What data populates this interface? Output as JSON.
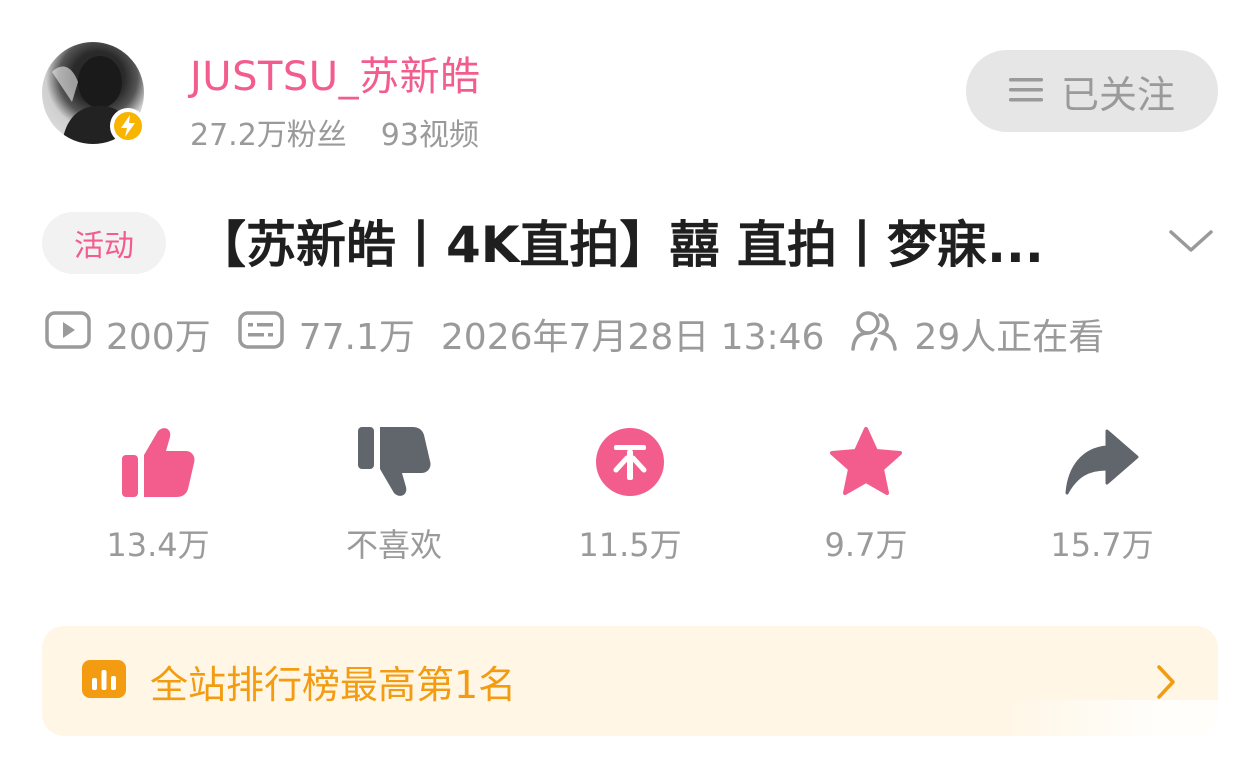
{
  "header": {
    "username": "JUSTSU_苏新皓",
    "followers": "27.2万粉丝",
    "videos": "93视频",
    "follow_button_label": "已关注",
    "follow_icon": "menu-lines-icon",
    "badge_icon": "lightning-icon"
  },
  "video": {
    "tag": "活动",
    "title": "【苏新皓丨4K直拍】囍 直拍丨梦寐...",
    "expand_icon": "chevron-down-icon",
    "meta": {
      "plays": "200万",
      "danmaku": "77.1万",
      "datetime": "2026年7月28日 13:46",
      "watching": "29人正在看"
    }
  },
  "actions": [
    {
      "name": "like",
      "label": "13.4万",
      "icon": "thumbs-up-icon",
      "color": "#f25d8e"
    },
    {
      "name": "dislike",
      "label": "不喜欢",
      "icon": "thumbs-down-icon",
      "color": "#61666d"
    },
    {
      "name": "coin",
      "label": "11.5万",
      "icon": "coin-icon",
      "color": "#f25d8e"
    },
    {
      "name": "favorite",
      "label": "9.7万",
      "icon": "star-icon",
      "color": "#f25d8e"
    },
    {
      "name": "share",
      "label": "15.7万",
      "icon": "share-arrow-icon",
      "color": "#61666d"
    }
  ],
  "ranking": {
    "text": "全站排行榜最高第1名",
    "icon": "bar-chart-icon",
    "color": "#f39c12"
  },
  "colors": {
    "accent": "#f25d8e",
    "muted": "#9a9a9a",
    "rank_bg": "#fff6e5"
  }
}
